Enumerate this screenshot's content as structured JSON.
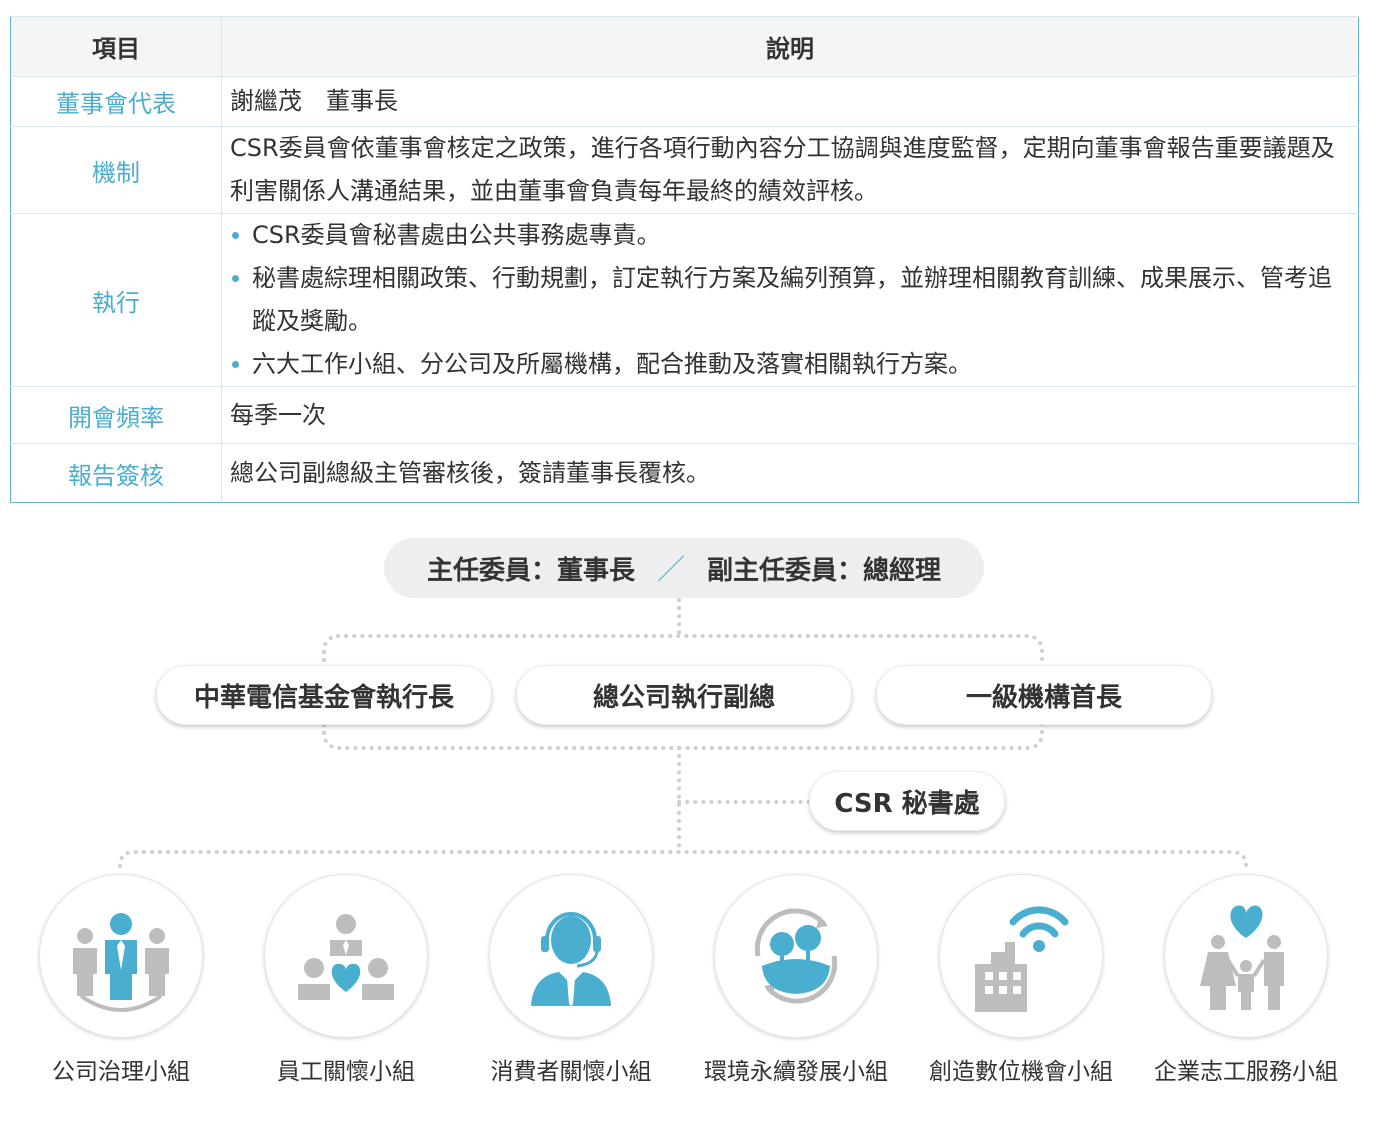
{
  "table": {
    "header": {
      "item": "項目",
      "desc": "說明"
    },
    "rows": [
      {
        "item": "董事會代表",
        "desc": "謝繼茂　董事長"
      },
      {
        "item": "機制",
        "desc": "CSR委員會依董事會核定之政策，進行各項行動內容分工協調與進度監督，定期向董事會報告重要議題及利害關係人溝通結果，並由董事會負責每年最終的績效評核。"
      },
      {
        "item": "執行",
        "bullets": [
          "CSR委員會秘書處由公共事務處專責。",
          "秘書處綜理相關政策、行動規劃，訂定執行方案及編列預算，並辦理相關教育訓練、成果展示、管考追蹤及獎勵。",
          "六大工作小組、分公司及所屬機構，配合推動及落實相關執行方案。"
        ]
      },
      {
        "item": "開會頻率",
        "desc": "每季一次"
      },
      {
        "item": "報告簽核",
        "desc": "總公司副總級主管審核後，簽請董事長覆核。"
      }
    ]
  },
  "org": {
    "chair": "主任委員：董事長",
    "vice_chair": "副主任委員：總經理",
    "members": [
      "中華電信基金會執行長",
      "總公司執行副總",
      "一級機構首長"
    ],
    "secretariat": "CSR 秘書處",
    "groups": [
      {
        "label": "公司治理小組",
        "icon": "corporate-governance-icon"
      },
      {
        "label": "員工關懷小組",
        "icon": "employee-care-icon"
      },
      {
        "label": "消費者關懷小組",
        "icon": "customer-service-icon"
      },
      {
        "label": "環境永續發展小組",
        "icon": "environment-icon"
      },
      {
        "label": "創造數位機會小組",
        "icon": "digital-opportunity-icon"
      },
      {
        "label": "企業志工服務小組",
        "icon": "volunteer-family-icon"
      }
    ]
  },
  "colors": {
    "accent": "#4aaed0",
    "icon_gray": "#bdbdbd",
    "border": "#5bb5d6"
  }
}
